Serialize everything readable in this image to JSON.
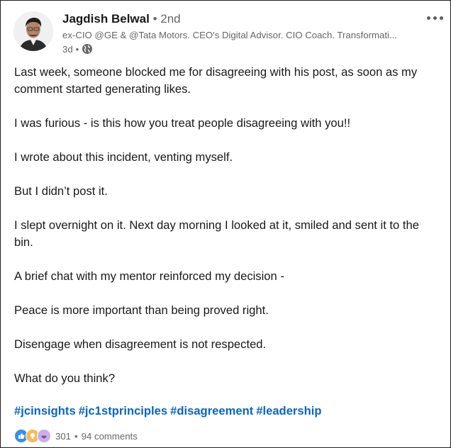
{
  "post": {
    "author": {
      "name": "Jagdish Belwal",
      "separator": "•",
      "degree": "2nd",
      "headline": "ex-CIO @GE & @Tata Motors. CEO's Digital Advisor. CIO Coach. Transformati...",
      "time": "3d",
      "time_separator": "•"
    },
    "paragraphs": [
      "Last week, someone blocked me for disagreeing with his post, as soon as my comment started generating likes.",
      "I was furious - is this how you treat people disagreeing with you!!",
      "I wrote about this incident, venting myself.",
      "But I didn’t post it.",
      "I slept overnight on it. Next day morning I looked at it, smiled and sent it to the bin.",
      "A brief chat with my mentor reinforced my decision -",
      "Peace is more important than being proved right.",
      "Disengage when disagreement is not respected.",
      "What do you think?"
    ],
    "hashtags": [
      "#jcinsights",
      "#jc1stprinciples",
      "#disagreement",
      "#leadership"
    ],
    "reactions": {
      "icons": [
        "like-icon",
        "insightful-icon",
        "support-icon"
      ],
      "count": "301",
      "separator": "•",
      "comments": "94 comments"
    }
  },
  "colors": {
    "link": "#0a66c2",
    "secondary_text": "#666666",
    "primary_text": "#191919"
  }
}
